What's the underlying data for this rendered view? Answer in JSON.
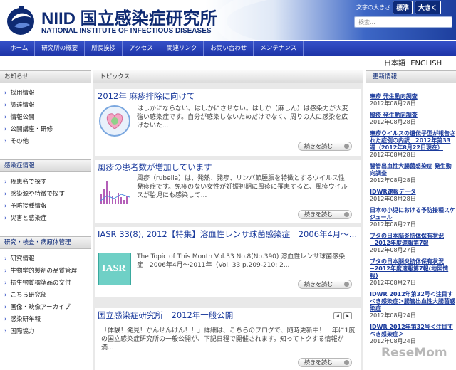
{
  "header": {
    "logo_title": "NIID 国立感染症研究所",
    "logo_subtitle": "NATIONAL INSTITUTE OF INFECTIOUS DISEASES",
    "font_size_label": "文字の大きさ",
    "font_standard": "標準",
    "font_large": "大きく",
    "search_placeholder": "検索..."
  },
  "nav": [
    "ホーム",
    "研究所の概要",
    "所長挨拶",
    "アクセス",
    "関連リンク",
    "お問い合わせ",
    "メンテナンス"
  ],
  "languages": [
    "日本語",
    "ENGLISH"
  ],
  "left": {
    "news_title": "お知らせ",
    "news_items": [
      "採用情報",
      "調達情報",
      "情報公開",
      "公開講座・研修",
      "その他"
    ],
    "disease_title": "感染症情報",
    "disease_items": [
      "疾患名で探す",
      "感染源や特徴で探す",
      "予防接種情報",
      "災害と感染症"
    ],
    "research_title": "研究・検査・病原体管理",
    "research_items": [
      "研究情報",
      "生物学的製剤の品質管理",
      "抗生物質標準品の交付",
      "こちら研究部",
      "画像・映像アーカイブ",
      "感染研年報",
      "国際協力"
    ]
  },
  "topics": {
    "title": "トピックス",
    "more_label": "続きを読む",
    "articles": [
      {
        "title": "2012年 麻疹排除に向けて",
        "text": "はしかにならない。はしかにさせない。はしか（麻しん）は感染力が大変強い感染症です。自分が感染しないためだけでなく、周りの人に感染を広げないた..."
      },
      {
        "title": "風疹の患者数が増加しています",
        "text": "風疹（rubella）は、発熱、発疹、リンパ節腫脹を特徴とするウイルス性発疹症です。免疫のない女性が妊娠初期に風疹に罹患すると、風疹ウイルスが胎児にも感染して..."
      },
      {
        "title": "IASR 33(8), 2012【特集】溶血性レンサ球菌感染症　2006年4月〜…",
        "text": "The Topic of This Month Vol.33 No.8(No.390) 溶血性レンサ球菌感染症　2006年4月〜2011年（Vol. 33 p.209-210: 2..."
      },
      {
        "title": "国立感染症研究所　2012年一般公開",
        "text": "「体験！発見！かんせんけん！！」詳細は、こちらのブログで、随時更新中！　年に1度の国立感染症研究所の一般公開が、下記日程で開催されます。知ってトクする情報が満..."
      }
    ],
    "thumb3_label": "IASR",
    "pager_prev": "◂",
    "pager_next": "▸"
  },
  "updates": {
    "title": "更新情報",
    "items": [
      {
        "title": "麻疹 発生動向調査",
        "date": "2012年08月28日"
      },
      {
        "title": "風疹 発生動向調査",
        "date": "2012年08月28日"
      },
      {
        "title": "麻疹ウイルスの遺伝子型が報告された症例の内訳　2012年第33週（2012年8月22日現在）",
        "date": "2012年08月28日"
      },
      {
        "title": "腸管出血性大腸菌感染症 発生動向調査",
        "date": "2012年08月28日"
      },
      {
        "title": "IDWR速報データ",
        "date": "2012年08月28日"
      },
      {
        "title": "日本の小児における予防接種スケジュール",
        "date": "2012年08月27日"
      },
      {
        "title": "ブタの日本脳炎抗体保有状況 −2012年度速報第7報",
        "date": "2012年08月27日"
      },
      {
        "title": "ブタの日本脳炎抗体保有状況 −2012年度速報第7報(地図情報)",
        "date": "2012年08月27日"
      },
      {
        "title": "IDWR 2012年第32号＜注目すべき感染症＞腸管出血性大腸菌感染症",
        "date": "2012年08月24日"
      },
      {
        "title": "IDWR 2012年第32号＜注目すべき感染症＞",
        "date": "2012年08月24日"
      }
    ]
  },
  "watermark": "ReseMom"
}
